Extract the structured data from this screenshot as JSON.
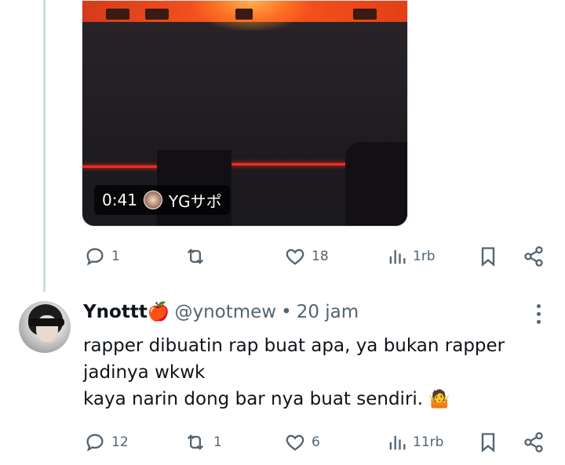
{
  "video": {
    "duration": "0:41",
    "source": "YGサポ"
  },
  "tweet_actions": {
    "replies": "1",
    "retweets": "",
    "likes": "18",
    "views": "1rb"
  },
  "reply": {
    "name": "Ynottt",
    "name_emoji": "🍎",
    "handle": "@ynotmew",
    "separator": "•",
    "time": "20 jam",
    "text_line1": "rapper dibuatin rap buat apa, ya bukan rapper",
    "text_line2": "jadinya wkwk",
    "text_line3": "kaya narin dong bar nya buat sendiri.",
    "text_emoji": "🤷",
    "actions": {
      "replies": "12",
      "retweets": "1",
      "likes": "6",
      "views": "11rb"
    }
  },
  "icons": [
    "reply-icon",
    "retweet-icon",
    "like-icon",
    "views-icon",
    "bookmark-icon",
    "share-icon",
    "more-icon"
  ],
  "colors": {
    "text": "#0f1419",
    "secondary": "#536471",
    "line": "#cfd9de"
  }
}
